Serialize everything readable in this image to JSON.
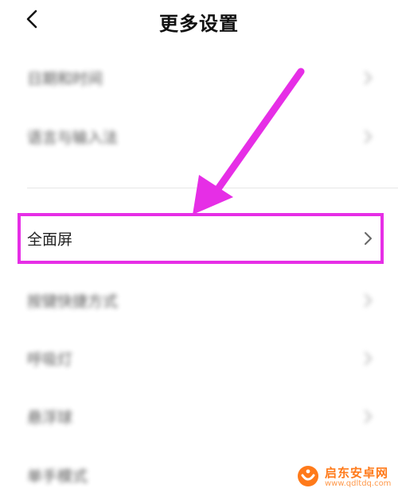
{
  "header": {
    "title": "更多设置",
    "back_icon": "chevron-left-icon"
  },
  "settings": {
    "items": [
      {
        "label": "日期和时间",
        "blurred": true
      },
      {
        "label": "语言与输入法",
        "blurred": true
      },
      {
        "label": "全面屏",
        "blurred": false,
        "highlighted": true
      },
      {
        "label": "按键快捷方式",
        "blurred": true
      },
      {
        "label": "呼吸灯",
        "blurred": true
      },
      {
        "label": "悬浮球",
        "blurred": true
      },
      {
        "label": "单手模式",
        "blurred": true
      }
    ]
  },
  "annotation": {
    "color": "#e62ee6"
  },
  "watermark": {
    "name": "启东安卓网",
    "url": "www.qdltdq.com",
    "color": "#ff7a1a"
  }
}
